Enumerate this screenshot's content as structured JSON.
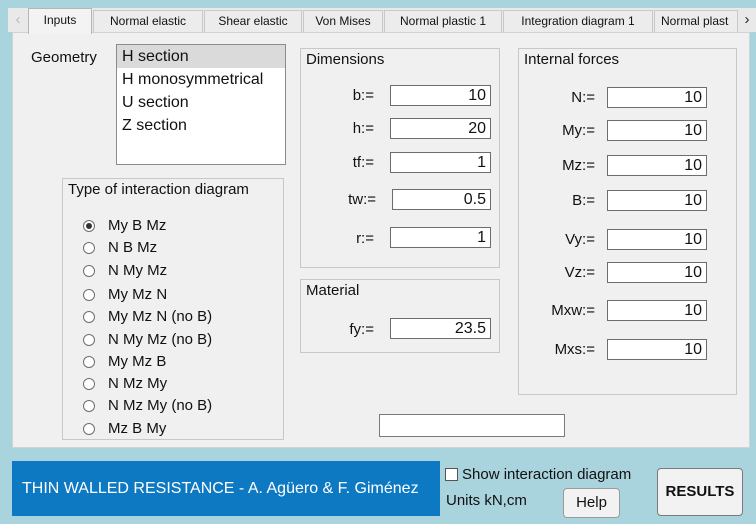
{
  "tabs": [
    {
      "label": "Inputs",
      "active": true
    },
    {
      "label": "Normal elastic"
    },
    {
      "label": "Shear elastic"
    },
    {
      "label": "Von Mises"
    },
    {
      "label": "Normal plastic 1"
    },
    {
      "label": "Integration diagram 1"
    },
    {
      "label": "Normal plast"
    }
  ],
  "tab_icons": {
    "left": "chevron-left-icon",
    "right": "chevron-right-icon"
  },
  "geometry": {
    "label": "Geometry",
    "options": [
      "H section",
      "H monosymmetrical",
      "U section",
      "Z section"
    ],
    "selected": "H section"
  },
  "dimensions": {
    "title": "Dimensions",
    "fields": [
      {
        "label": "b:=",
        "value": "10"
      },
      {
        "label": "h:=",
        "value": "20"
      },
      {
        "label": "tf:=",
        "value": "1"
      },
      {
        "label": "tw:=",
        "value": "0.5"
      },
      {
        "label": "r:=",
        "value": "1"
      }
    ]
  },
  "material": {
    "title": "Material",
    "fields": [
      {
        "label": "fy:=",
        "value": "23.5"
      }
    ]
  },
  "internal_forces": {
    "title": "Internal forces",
    "fields": [
      {
        "label": "N:=",
        "value": "10"
      },
      {
        "label": "My:=",
        "value": "10"
      },
      {
        "label": "Mz:=",
        "value": "10"
      },
      {
        "label": "B:=",
        "value": "10"
      },
      {
        "label": "Vy:=",
        "value": "10"
      },
      {
        "label": "Vz:=",
        "value": "10"
      },
      {
        "label": "Mxw:=",
        "value": "10"
      },
      {
        "label": "Mxs:=",
        "value": "10"
      }
    ]
  },
  "interaction": {
    "title": "Type of interaction diagram",
    "options": [
      "My B Mz",
      "N B Mz",
      "N My Mz",
      "My Mz N",
      "My Mz N (no B)",
      "N My Mz (no B)",
      "My Mz B",
      "N Mz My",
      "N Mz My (no B)",
      "Mz B My"
    ],
    "selected": "My B Mz"
  },
  "status_field": {
    "value": ""
  },
  "footer": {
    "banner": "THIN WALLED RESISTANCE - A. Agüero & F. Giménez",
    "show_diagram_label": "Show interaction diagram",
    "show_diagram_checked": false,
    "units": "Units kN,cm",
    "help_label": "Help",
    "results_label": "RESULTS"
  },
  "colors": {
    "background": "#a9d4de",
    "banner": "#0d79c3",
    "panel": "#f0f0f0"
  }
}
